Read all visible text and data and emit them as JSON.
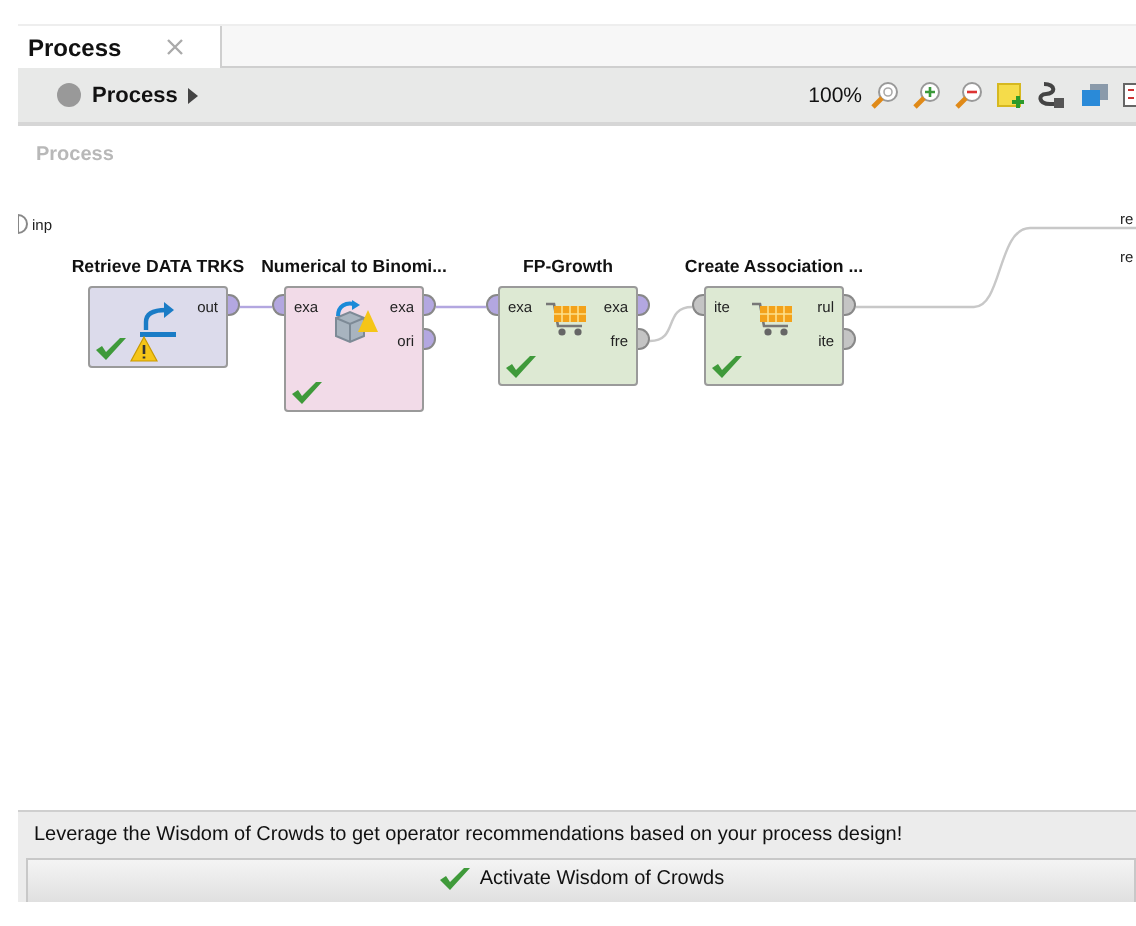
{
  "tabs": [
    {
      "label": "Process",
      "selected": true
    }
  ],
  "breadcrumb": {
    "label": "Process"
  },
  "toolbar": {
    "zoom": "100%"
  },
  "canvas": {
    "label": "Process",
    "input_ports": [
      {
        "label": "inp"
      }
    ],
    "output_ports": [
      {
        "label": "re"
      },
      {
        "label": "re"
      }
    ],
    "operators": [
      {
        "name": "Retrieve DATA TRKS",
        "kind": "retrieve",
        "color": "#dcdbeb",
        "checked": true,
        "warning": true,
        "outputs": [
          {
            "label": "out",
            "color": "#b3a7e0"
          }
        ]
      },
      {
        "name": "Numerical to Binomi...",
        "kind": "convert",
        "color": "#f2dbe8",
        "checked": true,
        "inputs": [
          {
            "label": "exa",
            "color": "#b3a7e0"
          }
        ],
        "outputs": [
          {
            "label": "exa",
            "color": "#b3a7e0"
          },
          {
            "label": "ori",
            "color": "#b3a7e0"
          }
        ]
      },
      {
        "name": "FP-Growth",
        "kind": "cart",
        "color": "#dde9d3",
        "checked": true,
        "inputs": [
          {
            "label": "exa",
            "color": "#b3a7e0"
          }
        ],
        "outputs": [
          {
            "label": "exa",
            "color": "#b3a7e0"
          },
          {
            "label": "fre",
            "color": "#c4c4c4"
          }
        ]
      },
      {
        "name": "Create Association ...",
        "kind": "cart",
        "color": "#dde9d3",
        "checked": true,
        "inputs": [
          {
            "label": "ite",
            "color": "#c4c4c4"
          }
        ],
        "outputs": [
          {
            "label": "rul",
            "color": "#c4c4c4"
          },
          {
            "label": "ite",
            "color": "#c4c4c4"
          }
        ]
      }
    ]
  },
  "wisdom": {
    "message": "Leverage the Wisdom of Crowds to get operator recommendations based on your process design!",
    "button": "Activate Wisdom of Crowds"
  }
}
